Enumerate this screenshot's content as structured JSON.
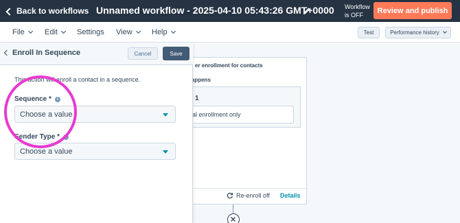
{
  "header": {
    "back_label": "Back to workflows",
    "title": "Unnamed workflow - 2025-04-10 05:43:26 GMT+0000",
    "status_line1": "Workflow",
    "status_line2": "is OFF",
    "publish_label": "Review and publish"
  },
  "menu": {
    "items": [
      "File",
      "Edit",
      "Settings",
      "View",
      "Help"
    ],
    "test_label": "Test",
    "performance_label": "Performance history"
  },
  "panel": {
    "title": "Enroll In Sequence",
    "cancel_label": "Cancel",
    "save_label": "Save",
    "description": "This action will enroll a contact in a sequence.",
    "sequence_label": "Sequence *",
    "sequence_value": "Choose a value",
    "sender_label": "Sender Type *",
    "sender_value": "Choose a value"
  },
  "canvas": {
    "card_header": "er enrollment for contacts",
    "card_sub": "happens",
    "card_number": "1",
    "card_field_text": "al enrollment only",
    "reenroll_label": "Re-enroll off",
    "details_label": "Details"
  },
  "colors": {
    "header_bg": "#253342",
    "publish": "#ff7a59",
    "highlight": "#e83ad0",
    "link": "#0091ae"
  }
}
